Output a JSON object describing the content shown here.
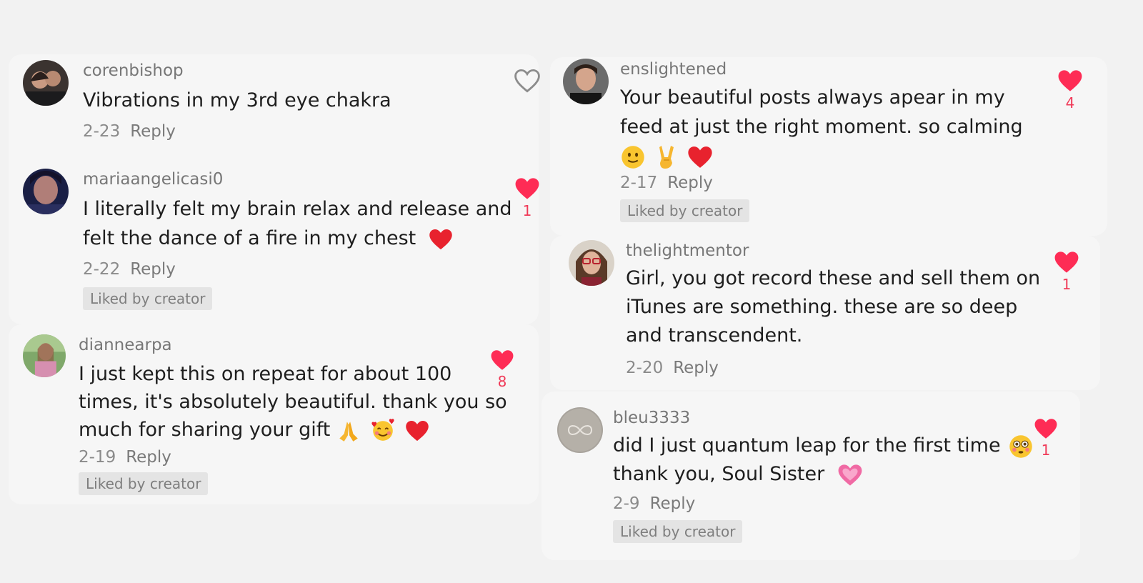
{
  "colors": {
    "heart_filled": "#fe2c55",
    "heart_outline": "#8c8c8c",
    "count_text": "#f03a58"
  },
  "comments": [
    {
      "username": "corenbishop",
      "lines": [
        "Vibrations in my 3rd eye chakra"
      ],
      "date": "2-23",
      "reply_label": "Reply",
      "like": {
        "icon": "heart-outline-icon",
        "count": ""
      }
    },
    {
      "username": "mariaangelicasi0",
      "lines": [
        "I literally felt my brain relax and release and",
        "felt the dance of a fire in my chest"
      ],
      "emojis": [
        "red-heart-emoji"
      ],
      "date": "2-22",
      "reply_label": "Reply",
      "liked_by_creator": "Liked by creator",
      "like": {
        "icon": "heart-filled-icon",
        "count": "1"
      }
    },
    {
      "username": "diannearpa",
      "lines": [
        "I just kept this on repeat for about 100",
        "times, it's absolutely beautiful. thank you so",
        "much for sharing your gift"
      ],
      "emojis": [
        "folded-hands-emoji",
        "smiling-face-with-hearts-emoji",
        "red-heart-emoji"
      ],
      "date": "2-19",
      "reply_label": "Reply",
      "liked_by_creator": "Liked by creator",
      "like": {
        "icon": "heart-filled-icon",
        "count": "8"
      }
    },
    {
      "username": "enslightened",
      "lines": [
        "Your beautiful posts always apear in my",
        "feed at just the right moment. so calming"
      ],
      "emojis": [
        "slightly-smiling-face-emoji",
        "victory-hand-emoji",
        "red-heart-emoji"
      ],
      "date": "2-17",
      "reply_label": "Reply",
      "liked_by_creator": "Liked by creator",
      "like": {
        "icon": "heart-filled-icon",
        "count": "4"
      }
    },
    {
      "username": "thelightmentor",
      "lines": [
        "Girl, you got record these and sell them on",
        "iTunes are something. these are so deep",
        "and transcendent."
      ],
      "date": "2-20",
      "reply_label": "Reply",
      "like": {
        "icon": "heart-filled-icon",
        "count": "1"
      }
    },
    {
      "username": "bleu3333",
      "lines": [
        "did I just quantum leap for the first time",
        "thank you, Soul Sister"
      ],
      "emojis": [
        "flushed-face-emoji",
        "growing-heart-emoji"
      ],
      "date": "2-9",
      "reply_label": "Reply",
      "liked_by_creator": "Liked by creator",
      "like": {
        "icon": "heart-filled-icon",
        "count": "1"
      }
    }
  ]
}
